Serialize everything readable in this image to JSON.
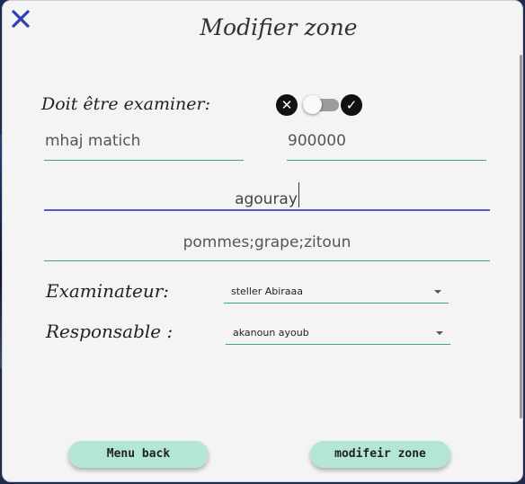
{
  "dialog": {
    "title": "Modifier zone"
  },
  "examine": {
    "label": "Doit être examiner:",
    "icons": [
      "close-circle-icon",
      "check-circle-icon"
    ],
    "switch_on": false
  },
  "fields": {
    "name": "mhaj matich",
    "number": "900000",
    "zone": "agouray",
    "products": "pommes;grape;zitoun"
  },
  "examinateur": {
    "label": "Examinateur:",
    "selected": "steller Abiraaa"
  },
  "responsable": {
    "label": "Responsable :",
    "selected": "akanoun ayoub"
  },
  "buttons": {
    "back": "Menu back",
    "submit": "modifeir zone"
  },
  "colors": {
    "accent_underline": "#3ba49a",
    "focus_underline": "#5558d6",
    "button_bg": "#b4e6d4",
    "close_icon": "#2f3fb0"
  }
}
